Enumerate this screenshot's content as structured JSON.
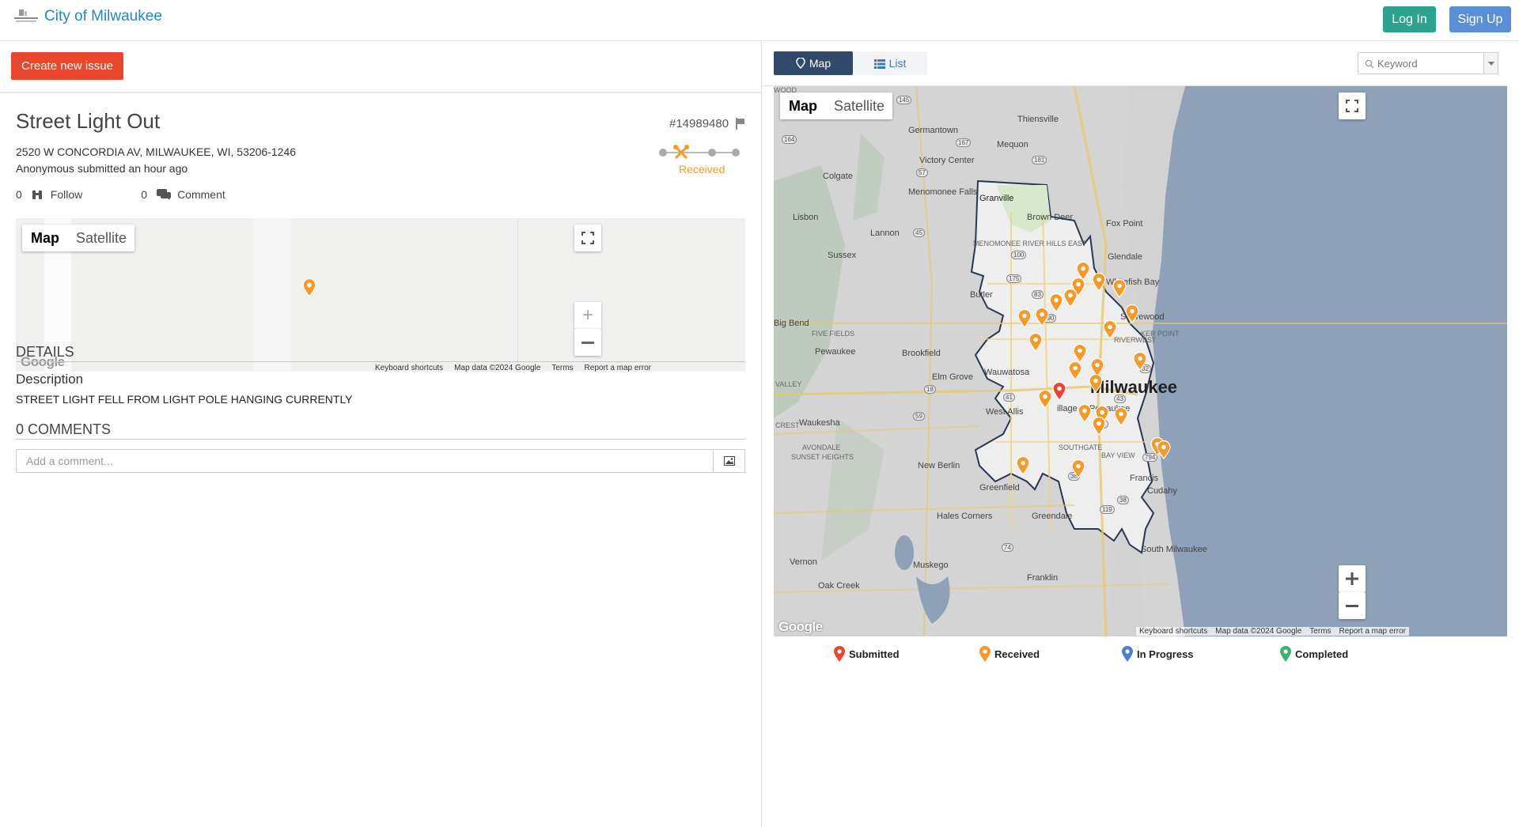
{
  "header": {
    "brand_title": "City of Milwaukee",
    "login_label": "Log In",
    "signup_label": "Sign Up",
    "colors": {
      "brand": "#1e88c9",
      "login": "#2ba38e",
      "signup": "#5a8fd6"
    }
  },
  "left": {
    "create_label": "Create new issue",
    "issue": {
      "title": "Street Light Out",
      "id": "#14989480",
      "address": "2520 W CONCORDIA AV, MILWAUKEE, WI, 53206-1246",
      "submitted": "Anonymous submitted an hour ago",
      "status": "Received",
      "follow_count": "0",
      "follow_label": "Follow",
      "comment_count": "0",
      "comment_label": "Comment"
    },
    "mini_map": {
      "map_label": "Map",
      "satellite_label": "Satellite",
      "google_logo": "Google",
      "footer": [
        "Keyboard shortcuts",
        "Map data ©2024 Google",
        "Terms",
        "Report a map error"
      ]
    },
    "details_heading": "DETAILS",
    "description_label": "Description",
    "description_text": "STREET LIGHT FELL FROM LIGHT POLE HANGING CURRENTLY",
    "comments_heading": "0 COMMENTS",
    "comment_placeholder": "Add a comment..."
  },
  "right": {
    "tab_map_label": "Map",
    "tab_list_label": "List",
    "keyword_placeholder": "Keyword",
    "big_map": {
      "map_label": "Map",
      "satellite_label": "Satellite",
      "google_logo": "Google",
      "footer": [
        "Keyboard shortcuts",
        "Map data ©2024 Google",
        "Terms",
        "Report a map error"
      ],
      "city_label": "Milwaukee",
      "places": [
        "Germantown",
        "Thiensville",
        "Mequon",
        "Victory Center",
        "Colgate",
        "Menomonee Falls",
        "Granville",
        "Brown Deer",
        "Fox Point",
        "Lisbon",
        "Lannon",
        "MENOMONEE RIVER HILLS EAST",
        "Glendale",
        "Sussex",
        "Whitefish Bay",
        "Butler",
        "Shorewood",
        "FIVE FIELDS",
        "Pewaukee",
        "Brookfield",
        "RIVERWEST",
        "Wauwatosa",
        "Elm Grove",
        "VALLEY",
        "West Allis",
        "Waukesha",
        "CREST",
        "AVONDALE",
        "SUNSET HEIGHTS",
        "SOUTHGATE",
        "BAY VIEW",
        "New Berlin",
        "Francis",
        "Greenfield",
        "Cudahy",
        "Hales Corners",
        "Greendale",
        "South Milwaukee",
        "Vernon",
        "Muskego",
        "Franklin",
        "Oak Creek",
        "Big Bend",
        "illage of Pewaukee",
        "KER POINT",
        "WOOD"
      ],
      "highway_shields": [
        "145",
        "167",
        "164",
        "181",
        "57",
        "175",
        "190",
        "100",
        "41",
        "94",
        "43",
        "59",
        "18",
        "119",
        "36",
        "38",
        "32",
        "794",
        "83",
        "45",
        "74"
      ]
    },
    "legend": [
      {
        "label": "Submitted",
        "color": "#e8462d"
      },
      {
        "label": "Received",
        "color": "#f39a2b"
      },
      {
        "label": "In Progress",
        "color": "#4a7fd4"
      },
      {
        "label": "Completed",
        "color": "#3cb371"
      }
    ]
  }
}
